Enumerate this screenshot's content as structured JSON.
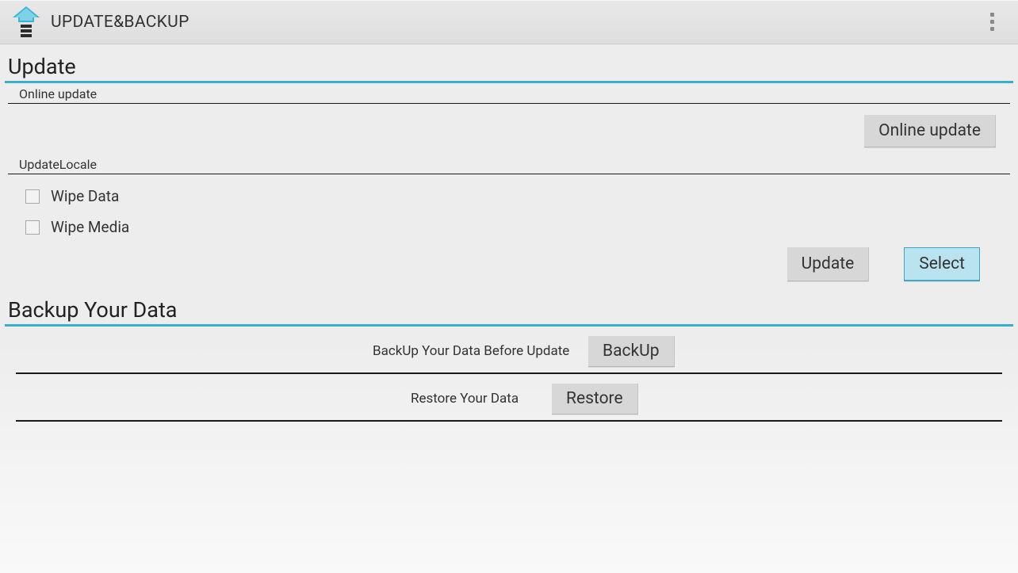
{
  "header": {
    "title": "UPDATE&BACKUP"
  },
  "update": {
    "section_title": "Update",
    "online_update_subhead": "Online update",
    "online_update_button": "Online update",
    "update_locale_subhead": "UpdateLocale",
    "wipe_data_label": "Wipe Data",
    "wipe_media_label": "Wipe Media",
    "update_button": "Update",
    "select_button": "Select"
  },
  "backup": {
    "section_title": "Backup Your Data",
    "backup_before_label": "BackUp Your Data Before Update",
    "backup_button": "BackUp",
    "restore_label": "Restore Your Data",
    "restore_button": "Restore"
  },
  "colors": {
    "accent": "#39aecf",
    "button_bg": "#d7d7d7",
    "select_button_bg": "#b9e3ee"
  }
}
